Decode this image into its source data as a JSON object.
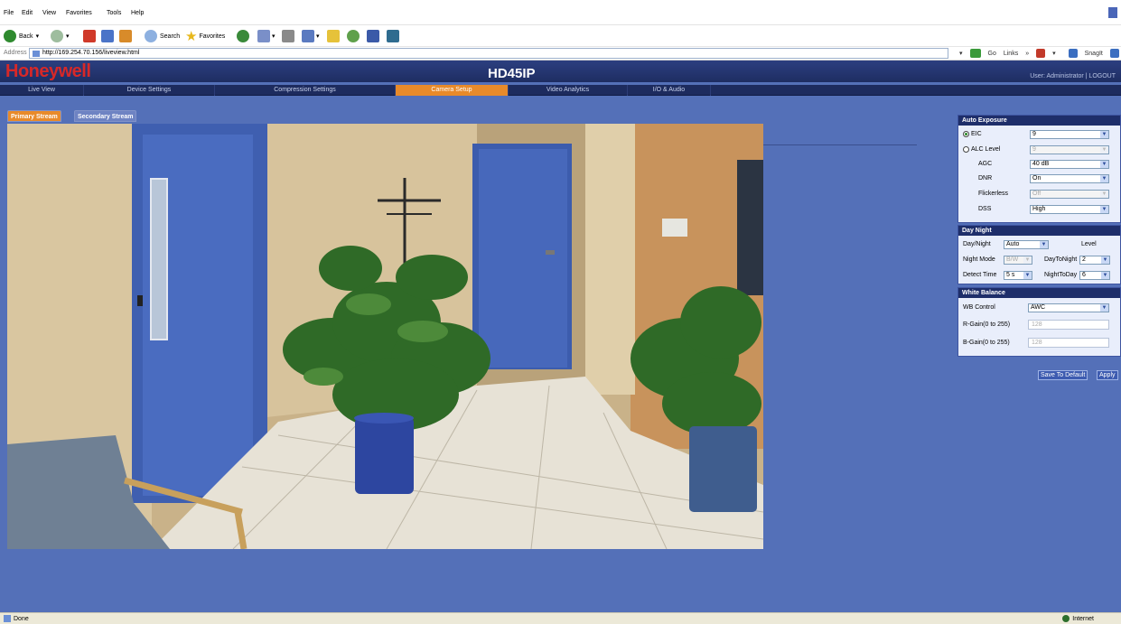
{
  "browser": {
    "menu": [
      "File",
      "Edit",
      "View",
      "Favorites",
      "Tools",
      "Help"
    ],
    "toolbar": {
      "back_label": "Back",
      "search_label": "Search",
      "favorites_label": "Favorites"
    },
    "address": {
      "label": "Address",
      "url": "http://169.254.70.156/liveview.html",
      "go_label": "Go",
      "links_label": "Links",
      "snagit_label": "SnagIt"
    },
    "status": {
      "left": "Done",
      "right": "Internet"
    }
  },
  "app": {
    "brand": "Honeywell",
    "device_title": "HD45IP",
    "user_info": "User: Administrator | LOGOUT",
    "nav_tabs": [
      "Live View",
      "Device Settings",
      "Compression Settings",
      "Camera Setup",
      "Video Analytics",
      "I/O & Audio"
    ],
    "active_nav": "Camera Setup",
    "stream_tabs": [
      "Primary Stream",
      "Secondary Stream"
    ],
    "active_stream": "Primary Stream"
  },
  "panel": {
    "auto_exposure": {
      "title": "Auto Exposure",
      "eic_label": "EIC",
      "eic_value": "9",
      "alc_label": "ALC Level",
      "alc_value": "9",
      "agc_label": "AGC",
      "agc_value": "40 dB",
      "dnr_label": "DNR",
      "dnr_value": "On",
      "flickerless_label": "Flickerless",
      "flickerless_value": "Off",
      "dss_label": "DSS",
      "dss_value": "High"
    },
    "day_night": {
      "title": "Day Night",
      "mode_label": "Day/Night",
      "mode_value": "Auto",
      "level_label": "Level",
      "night_mode_label": "Night Mode",
      "night_mode_value": "B/W",
      "day_to_night_label": "DayToNight",
      "day_to_night_value": "2",
      "detect_time_label": "Detect Time",
      "detect_time_value": "5 s",
      "night_to_day_label": "NightToDay",
      "night_to_day_value": "6"
    },
    "white_balance": {
      "title": "White Balance",
      "wb_control_label": "WB Control",
      "wb_control_value": "AWC",
      "r_gain_label": "R-Gain(0 to 255)",
      "r_gain_value": "128",
      "b_gain_label": "B-Gain(0 to 255)",
      "b_gain_value": "128"
    },
    "buttons": {
      "save_default": "Save To Default",
      "apply": "Apply"
    }
  },
  "colors": {
    "app_background": "#5470b8",
    "header": "#1e2d62",
    "active_tab": "#e88a2a",
    "brand_red": "#d72828"
  }
}
